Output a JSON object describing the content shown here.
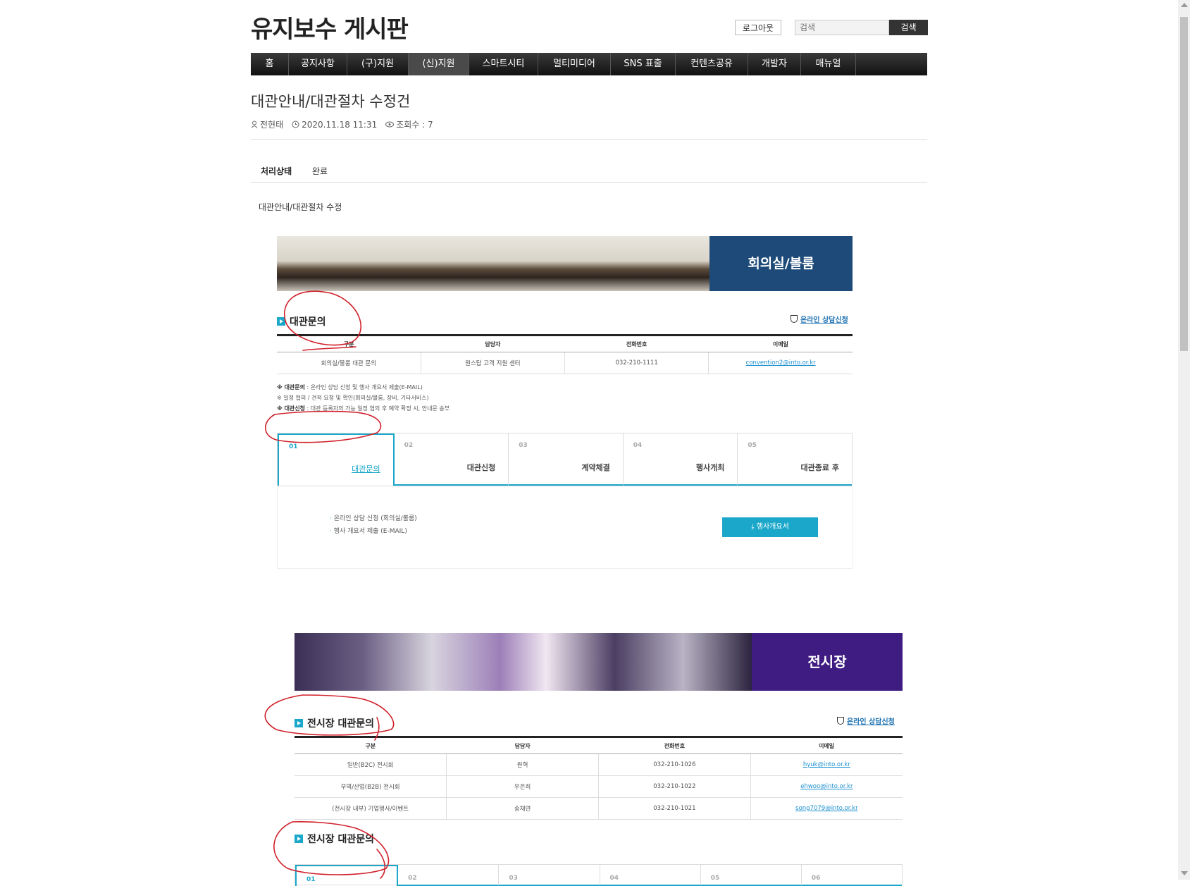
{
  "header": {
    "site_title": "유지보수 게시판",
    "logout_label": "로그아웃",
    "search_placeholder": "검색",
    "search_button": "검색"
  },
  "nav": {
    "items": [
      {
        "label": "홈"
      },
      {
        "label": "공지사항"
      },
      {
        "label": "(구)지원"
      },
      {
        "label": "(신)지원"
      },
      {
        "label": "스마트시티"
      },
      {
        "label": "멀티미디어"
      },
      {
        "label": "SNS 표출"
      },
      {
        "label": "컨텐츠공유"
      },
      {
        "label": "개발자"
      },
      {
        "label": "매뉴얼"
      }
    ]
  },
  "post": {
    "title": "대관안내/대관절차 수정건",
    "author": "전현태",
    "date": "2020.11.18 11:31",
    "views": "조회수 : 7",
    "status_label": "처리상태",
    "status_value": "완료",
    "body_text": "대관안내/대관절차 수정"
  },
  "image1": {
    "banner_label": "회의실/볼룸",
    "section_title": "대관문의",
    "online_link": "온라인 상담신청",
    "table": {
      "headers": [
        "구분",
        "담당자",
        "전화번호",
        "이메일"
      ],
      "rows": [
        [
          "회의실/볼룸 대관 문의",
          "원스탑 고객 지원 센터",
          "032-210-1111",
          "convention2@into.or.kr"
        ]
      ]
    },
    "notes": [
      {
        "bold": "※ 대관문의",
        "text": " : 온라인 상담 신청 및 행사 개요서 제출(E-MAIL)"
      },
      {
        "bold": "",
        "text": "※ 일정 협의 / 견적 요청 및 확인(회의실/볼룸, 장비, 기타서비스)"
      },
      {
        "bold": "※ 대관신청",
        "text": " : 대관 등록자의 가능 일정 협의 후 예약 확정 시, 안내문 송부"
      }
    ],
    "steps": [
      {
        "num": "01",
        "label": "대관문의"
      },
      {
        "num": "02",
        "label": "대관신청"
      },
      {
        "num": "03",
        "label": "계약체결"
      },
      {
        "num": "04",
        "label": "행사개최"
      },
      {
        "num": "05",
        "label": "대관종료 후"
      }
    ],
    "bullets": [
      "온라인 상담 신청 (회의실/볼룸)",
      "행사 개요서 제출 (E-MAIL)"
    ],
    "download_button": "⤓ 행사개요서"
  },
  "image2": {
    "banner_label": "전시장",
    "section_title": "전시장 대관문의",
    "online_link": "온라인 상담신청",
    "table": {
      "headers": [
        "구분",
        "담당자",
        "전화번호",
        "이메일"
      ],
      "rows": [
        [
          "일반(B2C) 전시회",
          "원혁",
          "032-210-1026",
          "hyuk@into.or.kr"
        ],
        [
          "무역/산업(B2B) 전시회",
          "우은희",
          "032-210-1022",
          "ehwoo@into.or.kr"
        ],
        [
          "(전시장 내부) 기업행사/이벤트",
          "송채연",
          "032-210-1021",
          "song7079@into.or.kr"
        ]
      ]
    },
    "section_title_2": "전시장 대관문의",
    "steps": [
      {
        "num": "01"
      },
      {
        "num": "02"
      },
      {
        "num": "03"
      },
      {
        "num": "04"
      },
      {
        "num": "05"
      },
      {
        "num": "06"
      }
    ]
  },
  "colors": {
    "accent": "#1aa7c9",
    "nav_bg": "#222222",
    "banner1": "#1d4a78",
    "banner2": "#3e1c82",
    "annotation": "#d0202a"
  }
}
